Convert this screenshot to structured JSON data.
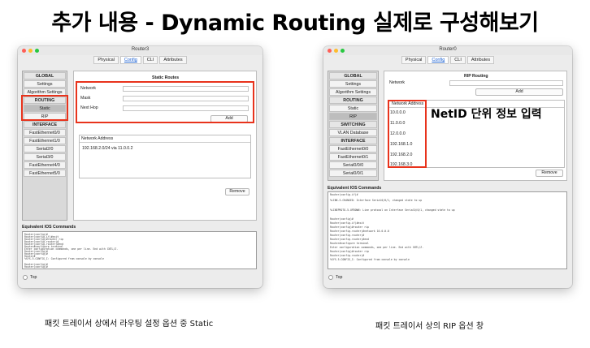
{
  "slide": {
    "title": "추가 내용 - Dynamic Routing 실제로 구성해보기",
    "caption_left": "패킷 트레이서 상에서 라우팅 설정 옵션 중 Static",
    "caption_right": "패킷 트레이서 상의 RIP 옵션 창",
    "annotation": "NetID 단위 정보 입력"
  },
  "left_window": {
    "title": "Router3",
    "tabs": [
      "Physical",
      "Config",
      "CLI",
      "Attributes"
    ],
    "active_tab": "Config",
    "nav": [
      "GLOBAL",
      "Settings",
      "Algorithm Settings",
      "ROUTING",
      "Static",
      "RIP",
      "INTERFACE",
      "FastEthernet0/0",
      "FastEthernet1/0",
      "Serial2/0",
      "Serial3/0",
      "FastEthernet4/0",
      "FastEthernet5/0"
    ],
    "panel_title": "Static Routes",
    "fields": [
      "Network",
      "Mask",
      "Next Hop"
    ],
    "add_label": "Add",
    "network_address_header": "Network Address",
    "network_entry": "192.168.2.0/24 via 11.0.0.2",
    "remove_label": "Remove",
    "ios_label": "Equivalent IOS Commands",
    "console_lines": [
      "Router(config)#",
      "Router(config-if)#exit",
      "Router(config)#router rip",
      "Router(config-router)#",
      "Router(config-router)#end",
      "Router#configure terminal",
      "Enter configuration commands, one per line.  End with CNTL/Z.",
      "Router(config)#",
      "Router(config)#",
      "Router#",
      "%SYS-5-CONFIG_I: Configured from console by console",
      "",
      "Router(config)#",
      "Router(config)#"
    ],
    "top_label": "Top"
  },
  "right_window": {
    "title": "Router0",
    "tabs": [
      "Physical",
      "Config",
      "CLI",
      "Attributes"
    ],
    "active_tab": "Config",
    "nav": [
      "GLOBAL",
      "Settings",
      "Algorithm Settings",
      "ROUTING",
      "Static",
      "RIP",
      "SWITCHING",
      "VLAN Database",
      "INTERFACE",
      "FastEthernet0/0",
      "FastEthernet0/1",
      "Serial0/0/0",
      "Serial0/0/1"
    ],
    "panel_title": "RIP Routing",
    "network_label": "Network",
    "add_label": "Add",
    "network_address_header": "Network Address",
    "networks": [
      "10.0.0.0",
      "11.0.0.0",
      "12.0.0.0",
      "192.168.1.0",
      "192.168.2.0",
      "192.168.3.0"
    ],
    "remove_label": "Remove",
    "ios_label": "Equivalent IOS Commands",
    "console_lines": [
      "Router(config-if)#",
      "%LINK-5-CHANGED: Interface Serial0/0/1, changed state to up",
      "",
      "%LINEPROTO-5-UPDOWN: Line protocol on Interface Serial0/0/1, changed state to up",
      "",
      "Router(config)#",
      "Router(config-if)#exit",
      "Router(config)#router rip",
      "Router(config-router)#network 10.0.0.0",
      "Router(config-router)#",
      "Router(config-router)#end",
      "Router#configure terminal",
      "Enter configuration commands, one per line.  End with CNTL/Z.",
      "Router(config)#router rip",
      "Router(config-router)#",
      "%SYS-5-CONFIG_I: Configured from console by console"
    ],
    "top_label": "Top"
  },
  "colors": {
    "highlight": "#e8331c",
    "light_red": "#ff5f57",
    "light_yellow": "#febc2e",
    "light_green": "#28c840"
  }
}
